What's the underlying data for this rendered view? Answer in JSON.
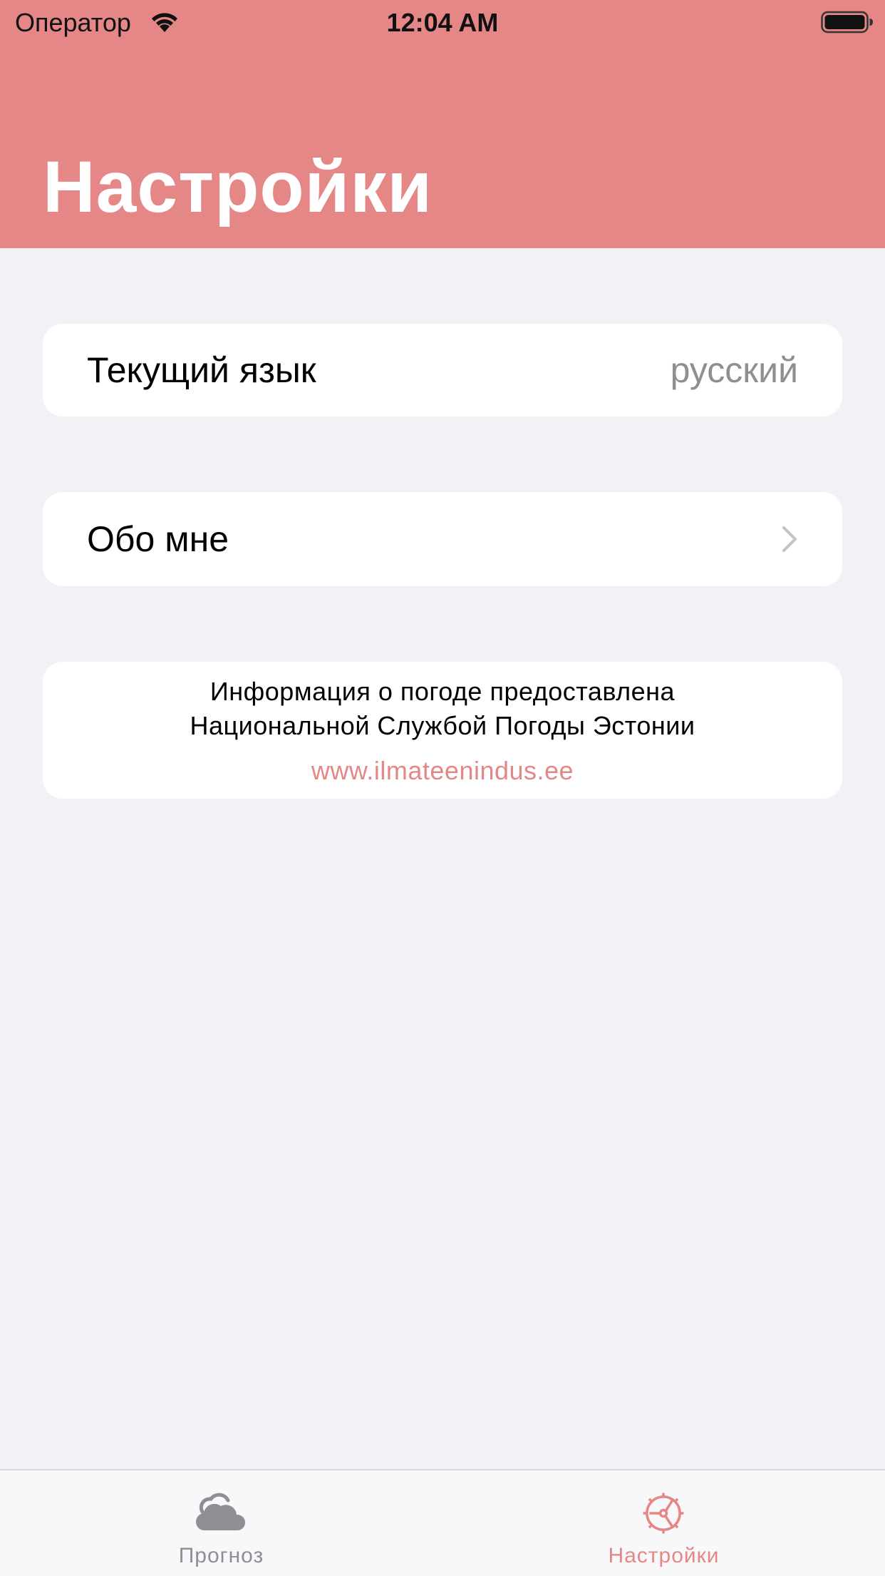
{
  "status_bar": {
    "carrier": "Оператор",
    "time": "12:04 AM"
  },
  "header": {
    "title": "Настройки"
  },
  "settings": {
    "language": {
      "label": "Текущий язык",
      "value": "русский"
    },
    "about": {
      "label": "Обо мне"
    },
    "info": {
      "line1": "Информация о погоде предоставлена",
      "line2": "Национальной Службой Погоды Эстонии",
      "link": "www.ilmateenindus.ee"
    }
  },
  "tab_bar": {
    "tabs": [
      {
        "label": "Прогноз",
        "icon": "cloud-icon",
        "active": false
      },
      {
        "label": "Настройки",
        "icon": "settings-gear-icon",
        "active": true
      }
    ]
  },
  "colors": {
    "accent": "#e58787",
    "background": "#f2f1f6",
    "inactive_tab": "#8e8e93"
  }
}
